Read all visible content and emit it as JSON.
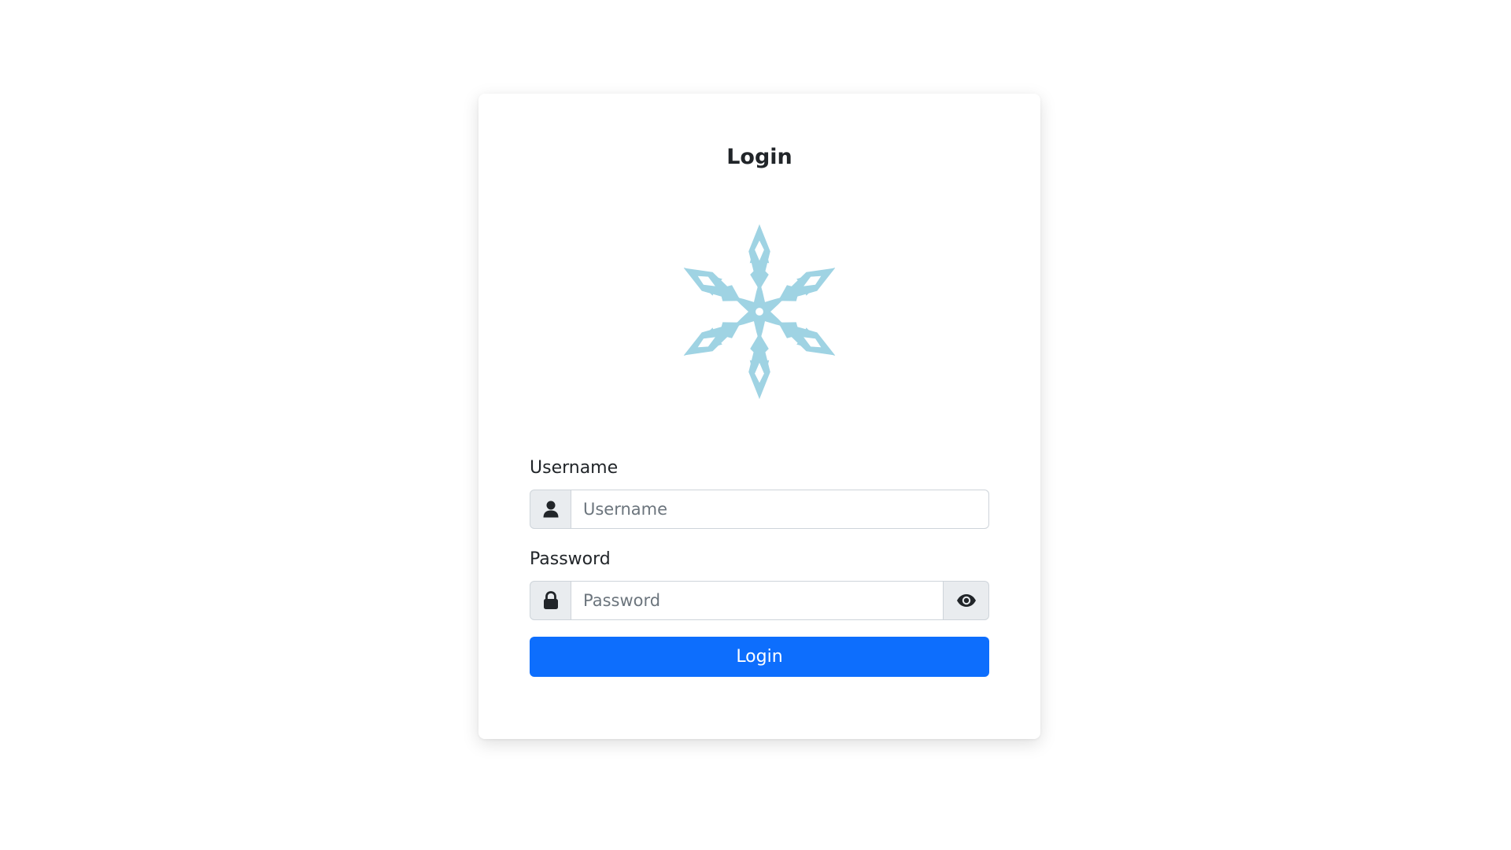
{
  "form": {
    "title": "Login",
    "logo_icon": "snowflake-logo",
    "logo_color": "#9fd3e3",
    "username": {
      "label": "Username",
      "placeholder": "Username",
      "value": "",
      "icon": "user-icon"
    },
    "password": {
      "label": "Password",
      "placeholder": "Password",
      "value": "",
      "icon": "lock-icon",
      "toggle_icon": "eye-icon"
    },
    "submit_label": "Login",
    "accent_color": "#0d6efd"
  }
}
